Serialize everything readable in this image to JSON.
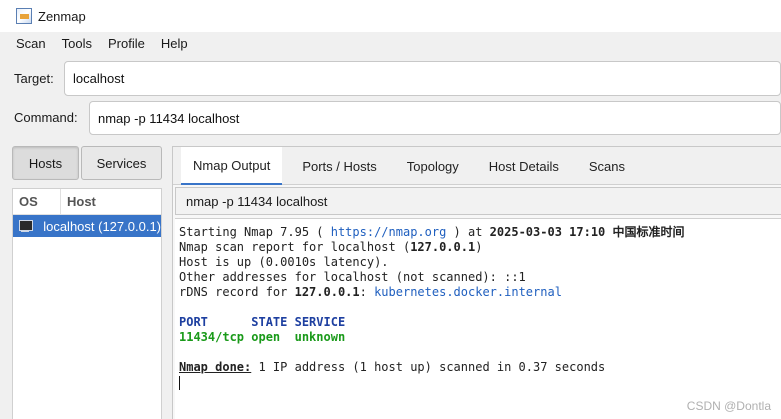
{
  "window": {
    "title": "Zenmap"
  },
  "menu": [
    "Scan",
    "Tools",
    "Profile",
    "Help"
  ],
  "target": {
    "label": "Target:",
    "value": "localhost"
  },
  "command": {
    "label": "Command:",
    "value": "nmap -p 11434 localhost"
  },
  "left_tabs": {
    "hosts": "Hosts",
    "services": "Services"
  },
  "hosts_table": {
    "col_os": "OS",
    "col_host": "Host",
    "rows": [
      {
        "host": "localhost (127.0.0.1)"
      }
    ]
  },
  "tabs": [
    "Nmap Output",
    "Ports / Hosts",
    "Topology",
    "Host Details",
    "Scans"
  ],
  "output": {
    "selected_command": "nmap -p 11434 localhost",
    "l1_pre": "Starting Nmap 7.95 ( ",
    "l1_url": "https://nmap.org",
    "l1_mid": " ) at ",
    "l1_time": "2025-03-03 17:10 中国标准时间",
    "l2_pre": "Nmap scan report for localhost (",
    "l2_ip": "127.0.0.1",
    "l2_post": ")",
    "l3": "Host is up (0.0010s latency).",
    "l4": "Other addresses for localhost (not scanned): ::1",
    "l5_pre": "rDNS record for ",
    "l5_ip": "127.0.0.1",
    "l5_sep": ": ",
    "l5_name": "kubernetes.docker.internal",
    "hdr": "PORT      STATE SERVICE",
    "port_row": "11434/tcp open  unknown",
    "done_label": "Nmap done:",
    "done_text": " 1 IP address (1 host up) scanned in 0.37 seconds"
  },
  "watermark": "CSDN @Dontla"
}
